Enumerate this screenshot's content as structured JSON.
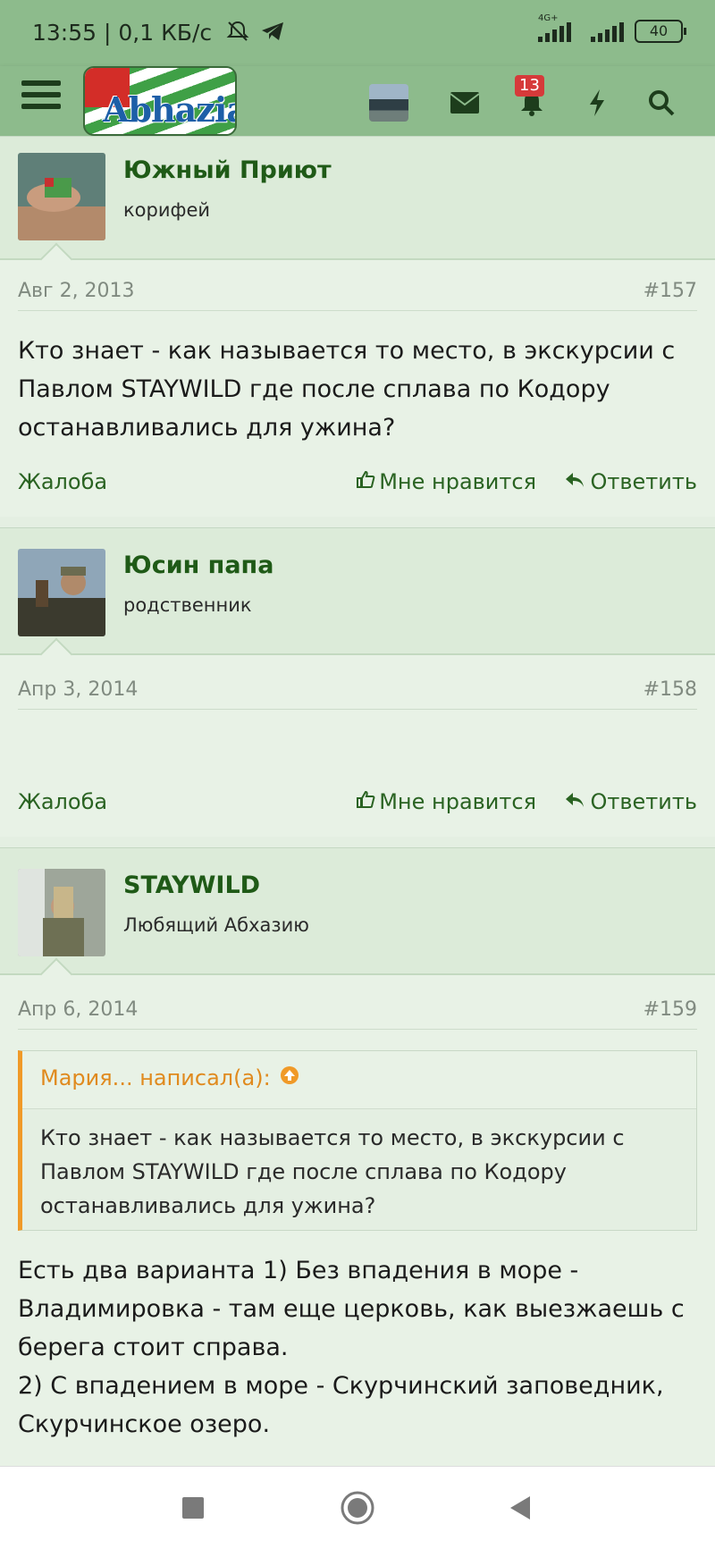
{
  "status_bar": {
    "time_speed": "13:55 | 0,1 КБ/с",
    "network_label": "4G+",
    "battery": "40"
  },
  "header": {
    "logo_text": "Abhazia",
    "notifications_count": "13"
  },
  "posts": [
    {
      "author": "Южный Приют",
      "user_title": "корифей",
      "date": "Авг 2, 2013",
      "number": "#157",
      "message": "Кто знает - как называется то место, в экскурсии с Павлом STAYWILD где после сплава по Кодору останавливались для ужина?"
    },
    {
      "author": "Юсин папа",
      "user_title": "родственник",
      "date": "Апр 3, 2014",
      "number": "#158",
      "message": ""
    },
    {
      "author": "STAYWILD",
      "user_title": "Любящий Абхазию",
      "date": "Апр 6, 2014",
      "number": "#159",
      "quote_author": "Мария... написал(а):",
      "quote_text": "Кто знает - как называется то место, в экскурсии с Павлом STAYWILD где после сплава по Кодору останавливались для ужина?",
      "message_line1": "Есть два варианта 1) Без впадения в море - Владимировка - там еще церковь, как выезжаешь с берега стоит справа.",
      "message_line2": "2) С впадением в море - Скурчинский заповедник, Скурчинское озеро."
    }
  ],
  "actions": {
    "complain": "Жалоба",
    "like": "Мне нравится",
    "reply": "Ответить"
  },
  "colors": {
    "header_green": "#8dbb8c",
    "username_green": "#1f5a17",
    "quote_orange": "#f09a28",
    "badge_red": "#d63a3a"
  }
}
